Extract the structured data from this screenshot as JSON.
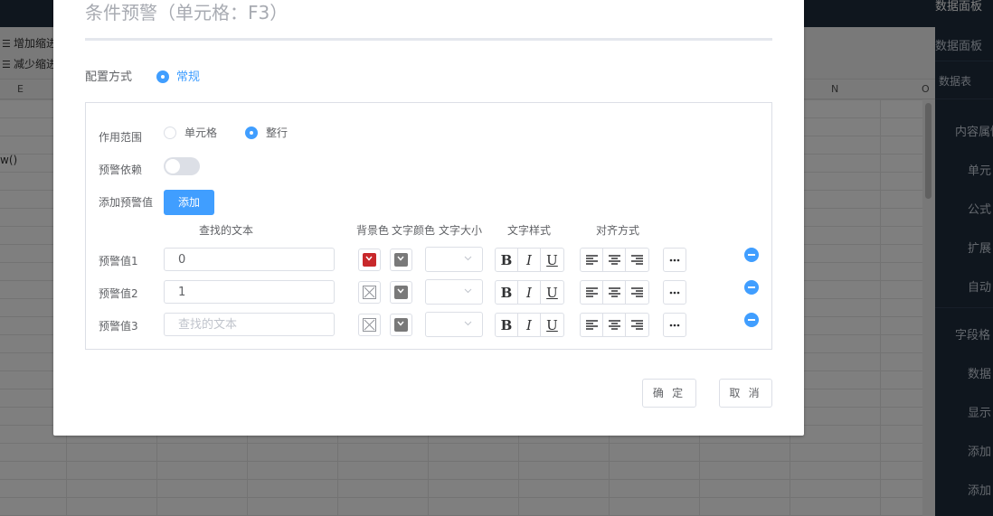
{
  "background": {
    "topbar_right": "数据面板",
    "toolbar": {
      "indent_add": "增加缩进",
      "indent_remove": "减少缩进"
    },
    "columns": [
      "E",
      "N",
      "O"
    ],
    "cell_text": "w()",
    "right_panel": [
      "数据面板",
      "数据表",
      "内容属性",
      "单元",
      "公式",
      "扩展",
      "自动",
      "字段格",
      "数据",
      "显示",
      "添加",
      "添加"
    ]
  },
  "dialog": {
    "title": "条件预警（单元格：F3）",
    "config_label": "配置方式",
    "config_option": "常规",
    "scope_label": "作用范围",
    "scope_options": [
      "单元格",
      "整行"
    ],
    "scope_selected": "整行",
    "dependency_label": "预警依赖",
    "dependency_on": false,
    "add_label": "添加预警值",
    "add_button": "添加",
    "columns": {
      "search_text": "查找的文本",
      "bg_color": "背景色",
      "text_color": "文字颜色",
      "font_size": "文字大小",
      "text_style": "文字样式",
      "align": "对齐方式"
    },
    "rows": [
      {
        "label": "预警值1",
        "value": "0",
        "placeholder": "查找的文本",
        "bg_color": "#c8282b",
        "text_color": "#797979"
      },
      {
        "label": "预警值2",
        "value": "1",
        "placeholder": "查找的文本",
        "bg_color": "",
        "text_color": "#797979"
      },
      {
        "label": "预警值3",
        "value": "",
        "placeholder": "查找的文本",
        "bg_color": "",
        "text_color": "#797979"
      }
    ],
    "style_buttons": [
      "B",
      "I",
      "U"
    ],
    "confirm": "确 定",
    "cancel": "取 消"
  },
  "colors": {
    "accent": "#409eff",
    "header_bg": "#1f2d3d"
  }
}
